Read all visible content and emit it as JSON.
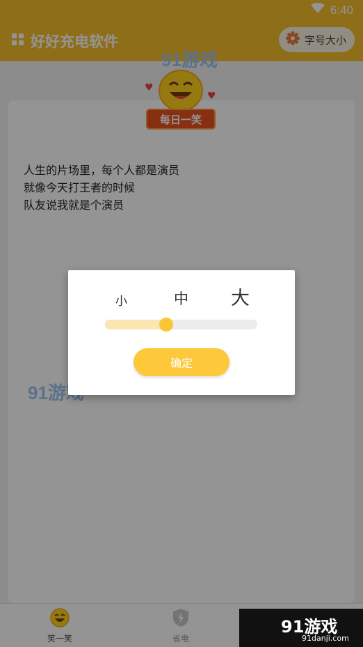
{
  "status_bar": {
    "time": "6:40",
    "wifi_icon": "wifi-icon"
  },
  "app_bar": {
    "title": "好好充电软件",
    "menu_icon": "grid-icon",
    "font_size_button": {
      "label": "字号大小",
      "icon": "gear-icon"
    }
  },
  "badge": {
    "label": "每日一笑",
    "icon": "laughing-face-icon"
  },
  "joke": {
    "lines": [
      "人生的片场里，每个人都是演员",
      "就像今天打王者的时候",
      "队友说我就是个演员"
    ]
  },
  "dialog": {
    "options": {
      "small": "小",
      "medium": "中",
      "large": "大"
    },
    "slider": {
      "level": 0.4
    },
    "confirm_label": "确定"
  },
  "bottom_nav": {
    "items": [
      {
        "label": "笑一笑",
        "icon": "laughing-face-icon",
        "active": true
      },
      {
        "label": "省电",
        "icon": "shield-bolt-icon",
        "active": false
      }
    ]
  },
  "watermark": {
    "brand": "91游戏",
    "site": "91danji.com"
  },
  "colors": {
    "primary": "#f7bd2d",
    "accent": "#fdc83a",
    "badge": "#e8541e"
  }
}
